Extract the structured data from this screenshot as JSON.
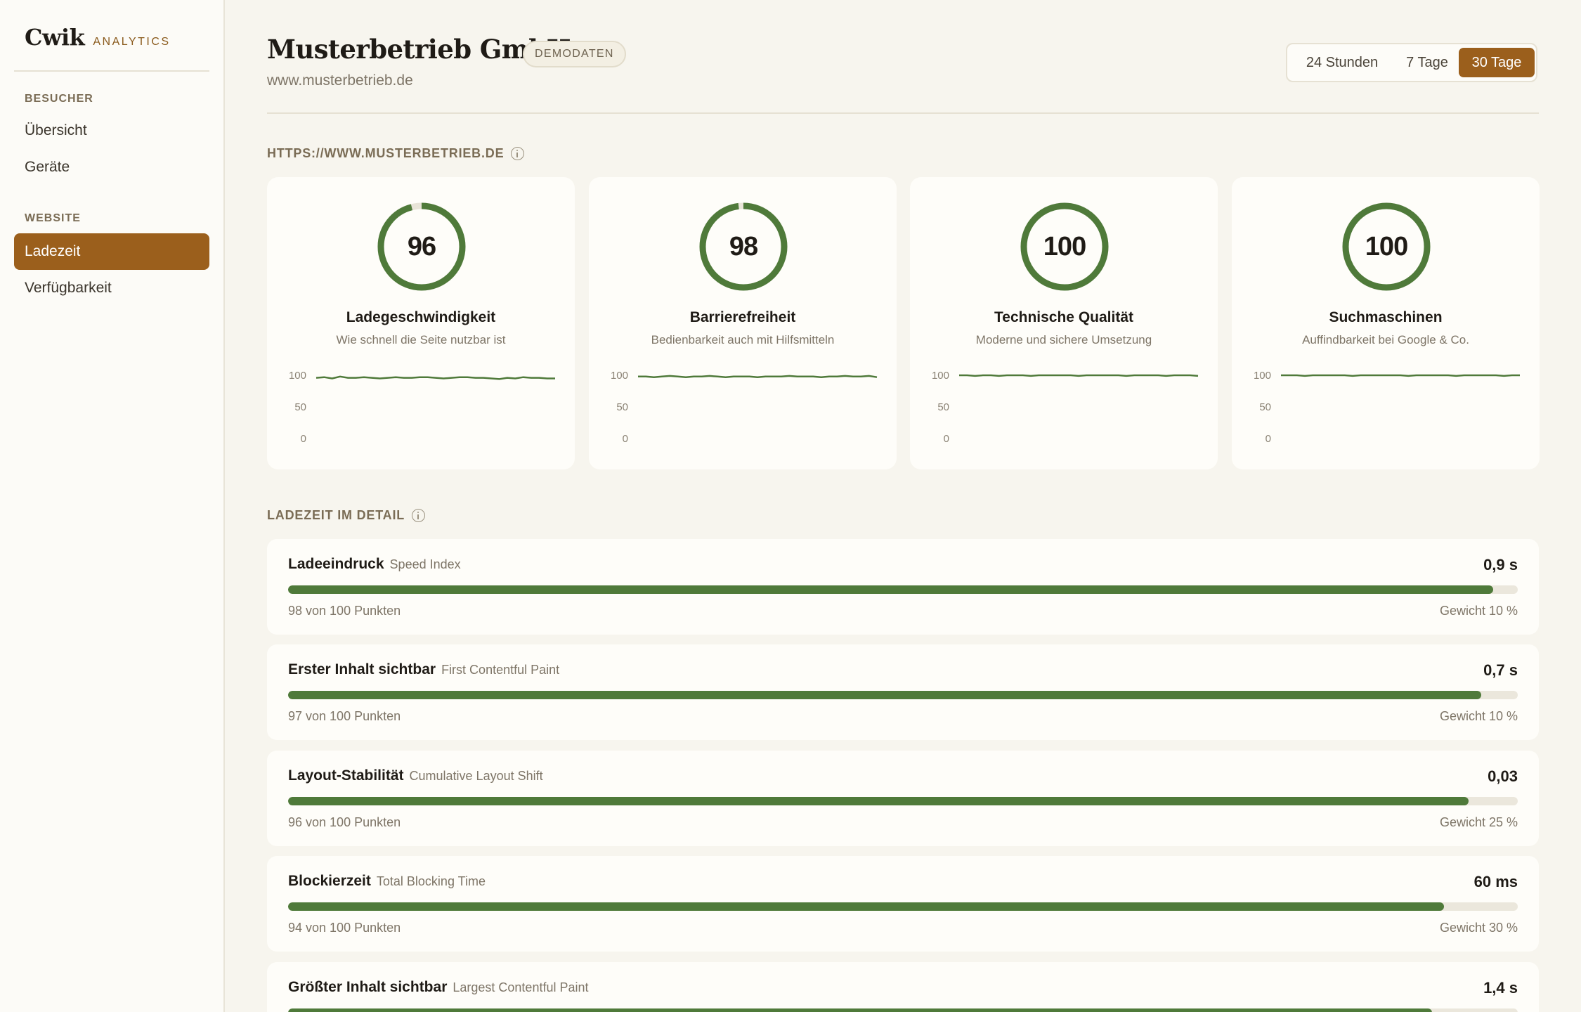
{
  "sidebar": {
    "logo": "Cwik",
    "logo_sub": "ANALYTICS",
    "sections": [
      {
        "label": "BESUCHER",
        "items": [
          {
            "label": "Übersicht"
          },
          {
            "label": "Geräte"
          }
        ]
      },
      {
        "label": "WEBSITE",
        "items": [
          {
            "label": "Ladezeit",
            "active": true
          },
          {
            "label": "Verfügbarkeit"
          }
        ]
      }
    ]
  },
  "header": {
    "title": "Musterbetrieb GmbH",
    "badge": "DEMODATEN",
    "url": "www.musterbetrieb.de",
    "ranges": [
      {
        "label": "24 Stunden",
        "active": false
      },
      {
        "label": "7 Tage",
        "active": false
      },
      {
        "label": "30 Tage",
        "active": true
      }
    ]
  },
  "scores_section": {
    "label": "HTTPS://WWW.MUSTERBETRIEB.DE",
    "cards": [
      {
        "score": "96",
        "value": 96,
        "title": "Ladegeschwindigkeit",
        "subtitle": "Wie schnell die Seite nutzbar ist",
        "y_ticks": [
          "100",
          "50",
          "0"
        ],
        "trend": [
          96,
          97,
          95,
          98,
          96,
          96,
          97,
          96,
          95,
          96,
          97,
          96,
          96,
          97,
          97,
          96,
          95,
          96,
          97,
          97,
          96,
          96,
          95,
          94,
          96,
          95,
          97,
          96,
          96,
          95,
          95
        ]
      },
      {
        "score": "98",
        "value": 98,
        "title": "Barrierefreiheit",
        "subtitle": "Bedienbarkeit auch mit Hilfsmitteln",
        "y_ticks": [
          "100",
          "50",
          "0"
        ],
        "trend": [
          98,
          98,
          97,
          98,
          99,
          98,
          97,
          98,
          98,
          99,
          98,
          97,
          98,
          98,
          98,
          97,
          98,
          98,
          98,
          99,
          98,
          98,
          98,
          97,
          98,
          98,
          99,
          98,
          98,
          99,
          97
        ]
      },
      {
        "score": "100",
        "value": 100,
        "title": "Technische Qualität",
        "subtitle": "Moderne und sichere Umsetzung",
        "y_ticks": [
          "100",
          "50",
          "0"
        ],
        "trend": [
          100,
          100,
          99,
          100,
          100,
          99,
          100,
          100,
          100,
          99,
          100,
          100,
          100,
          100,
          100,
          99,
          100,
          100,
          100,
          100,
          100,
          99,
          100,
          100,
          100,
          100,
          99,
          100,
          100,
          100,
          99
        ]
      },
      {
        "score": "100",
        "value": 100,
        "title": "Suchmaschinen",
        "subtitle": "Auffindbarkeit bei Google & Co.",
        "y_ticks": [
          "100",
          "50",
          "0"
        ],
        "trend": [
          100,
          100,
          100,
          99,
          100,
          100,
          100,
          100,
          100,
          99,
          100,
          100,
          100,
          100,
          100,
          100,
          99,
          100,
          100,
          100,
          100,
          100,
          99,
          100,
          100,
          100,
          100,
          100,
          99,
          100,
          100
        ]
      }
    ]
  },
  "detail_section": {
    "label": "LADEZEIT IM DETAIL",
    "metrics": [
      {
        "name": "Ladeeindruck",
        "sub": "Speed Index",
        "value": "0,9 s",
        "score": 98,
        "points": "98 von 100 Punkten",
        "weight": "Gewicht 10 %"
      },
      {
        "name": "Erster Inhalt sichtbar",
        "sub": "First Contentful Paint",
        "value": "0,7 s",
        "score": 97,
        "points": "97 von 100 Punkten",
        "weight": "Gewicht 10 %"
      },
      {
        "name": "Layout-Stabilität",
        "sub": "Cumulative Layout Shift",
        "value": "0,03",
        "score": 96,
        "points": "96 von 100 Punkten",
        "weight": "Gewicht 25 %"
      },
      {
        "name": "Blockierzeit",
        "sub": "Total Blocking Time",
        "value": "60 ms",
        "score": 94,
        "points": "94 von 100 Punkten",
        "weight": "Gewicht 30 %"
      },
      {
        "name": "Größter Inhalt sichtbar",
        "sub": "Largest Contentful Paint",
        "value": "1,4 s",
        "score": 93,
        "points": "",
        "weight": ""
      }
    ]
  },
  "colors": {
    "accent": "#9b5f1c",
    "good": "#4f7a3a",
    "track": "#ebe7dc"
  }
}
